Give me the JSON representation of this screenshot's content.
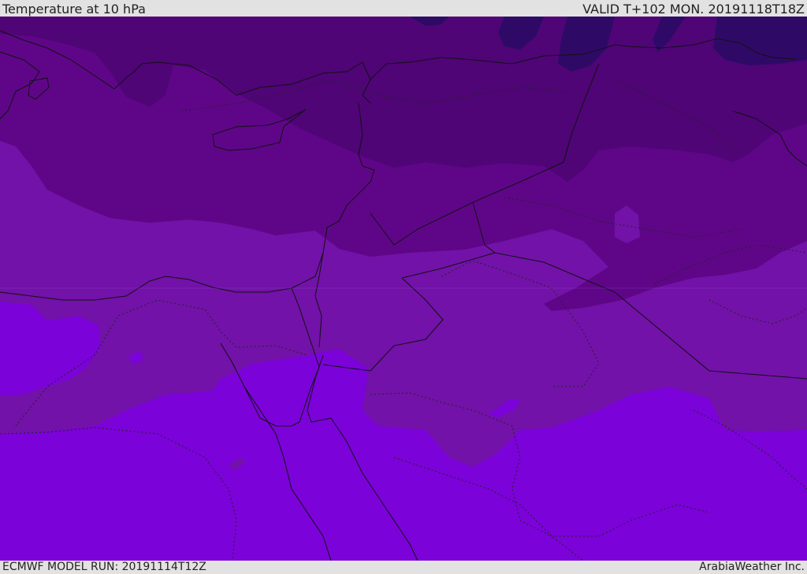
{
  "header": {
    "title": "Temperature at 10 hPa",
    "valid": "VALID T+102 MON. 20191118T18Z"
  },
  "footer": {
    "model_run": "ECMWF MODEL RUN: 20191114T12Z",
    "credit": "ArabiaWeather Inc."
  },
  "legend_colors": {
    "coldest": "#2e0a66",
    "very_cold": "#4f0576",
    "cold": "#5f0688",
    "cool": "#7212a8",
    "mild": "#7b02d8"
  }
}
